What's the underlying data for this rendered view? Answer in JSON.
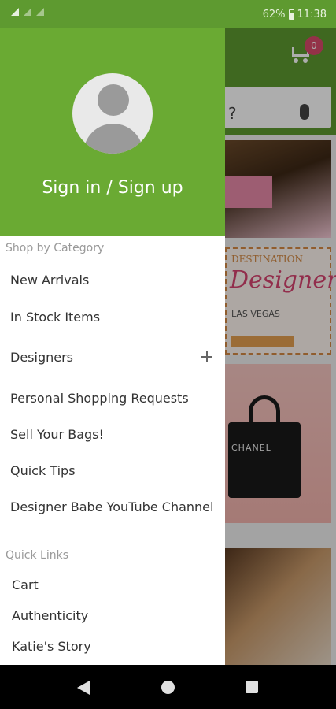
{
  "status_bar": {
    "battery": "62%",
    "time": "11:38"
  },
  "background": {
    "cart_badge": "0",
    "images": [
      "designer-bag-photo",
      "destination-designer-banner",
      "chanel-bag-photo",
      "bracelets-photo"
    ]
  },
  "drawer": {
    "sign_in_label": "Sign in / Sign up",
    "shop_by_category_title": "Shop by Category",
    "categories": [
      {
        "label": "New Arrivals"
      },
      {
        "label": "In Stock Items"
      },
      {
        "label": "Designers",
        "expandable": true
      },
      {
        "label": "Personal Shopping Requests"
      },
      {
        "label": "Sell Your Bags!"
      },
      {
        "label": "Quick Tips"
      },
      {
        "label": "Designer Babe YouTube Channel"
      }
    ],
    "quick_links_title": "Quick Links",
    "quick_links": [
      {
        "label": "Cart"
      },
      {
        "label": "Authenticity"
      },
      {
        "label": "Katie's Story"
      }
    ]
  },
  "colors": {
    "drawer_header": "#6aaa33",
    "toolbar": "#5e9a30",
    "badge": "#d94a6a"
  }
}
